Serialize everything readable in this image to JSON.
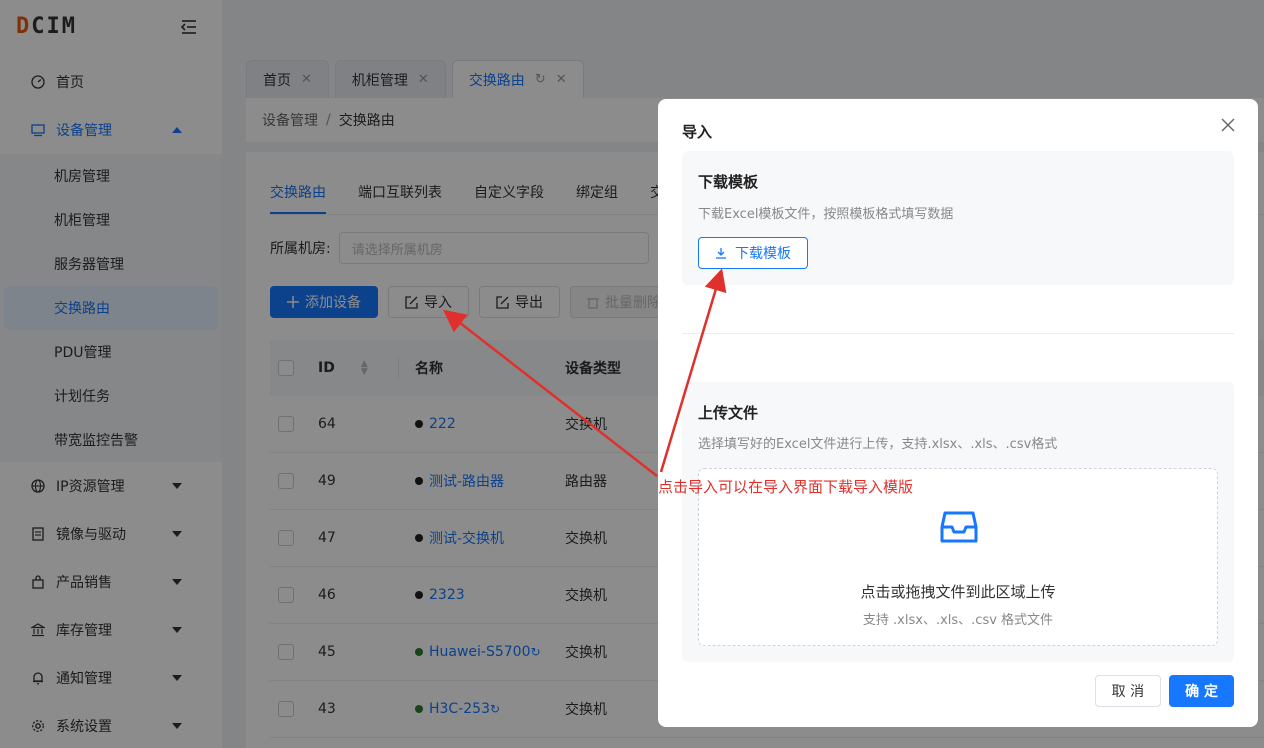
{
  "app": {
    "logo": "DCIM"
  },
  "sidebar": {
    "items": [
      {
        "label": "首页",
        "icon": "dashboard-icon"
      },
      {
        "label": "设备管理",
        "icon": "monitor-icon",
        "open": true,
        "children": [
          "机房管理",
          "机柜管理",
          "服务器管理",
          "交换路由",
          "PDU管理",
          "计划任务",
          "带宽监控告警"
        ],
        "active_child": "交换路由"
      },
      {
        "label": "IP资源管理",
        "icon": "globe-icon"
      },
      {
        "label": "镜像与驱动",
        "icon": "image-icon"
      },
      {
        "label": "产品销售",
        "icon": "bag-icon"
      },
      {
        "label": "库存管理",
        "icon": "bank-icon"
      },
      {
        "label": "通知管理",
        "icon": "bell-icon"
      },
      {
        "label": "系统设置",
        "icon": "gear-icon"
      }
    ]
  },
  "tabs": [
    {
      "label": "首页",
      "active": false
    },
    {
      "label": "机柜管理",
      "active": false
    },
    {
      "label": "交换路由",
      "active": true
    }
  ],
  "breadcrumb": {
    "parent": "设备管理",
    "separator": "/",
    "current": "交换路由"
  },
  "subtabs": [
    "交换路由",
    "端口互联列表",
    "自定义字段",
    "绑定组",
    "交"
  ],
  "filter": {
    "label": "所属机房:",
    "placeholder": "请选择所属机房"
  },
  "actions": {
    "add": "添加设备",
    "import": "导入",
    "export": "导出",
    "batch_delete": "批量删除"
  },
  "table": {
    "headers": {
      "id": "ID",
      "name": "名称",
      "type": "设备类型"
    },
    "rows": [
      {
        "id": "64",
        "name": "222",
        "type": "交换机"
      },
      {
        "id": "49",
        "name": "测试-路由器",
        "type": "路由器"
      },
      {
        "id": "47",
        "name": "测试-交换机",
        "type": "交换机"
      },
      {
        "id": "46",
        "name": "2323",
        "type": "交换机"
      },
      {
        "id": "45",
        "name": "Huawei-S5700",
        "type": "交换机"
      },
      {
        "id": "43",
        "name": "H3C-253",
        "type": "交换机"
      }
    ]
  },
  "modal": {
    "title": "导入",
    "download": {
      "title": "下载模板",
      "desc": "下载Excel模板文件，按照模板格式填写数据",
      "button": "下载模板"
    },
    "upload": {
      "title": "上传文件",
      "desc": "选择填写好的Excel文件进行上传，支持.xlsx、.xls、.csv格式",
      "main": "点击或拖拽文件到此区域上传",
      "sub": "支持 .xlsx、.xls、.csv 格式文件"
    },
    "cancel": "取 消",
    "confirm": "确 定"
  },
  "annotation": {
    "text": "点击导入可以在导入界面下载导入模版",
    "color": "#e0302b"
  },
  "colors": {
    "primary": "#1677ff",
    "overlay": "rgba(0,0,0,0.45)"
  }
}
